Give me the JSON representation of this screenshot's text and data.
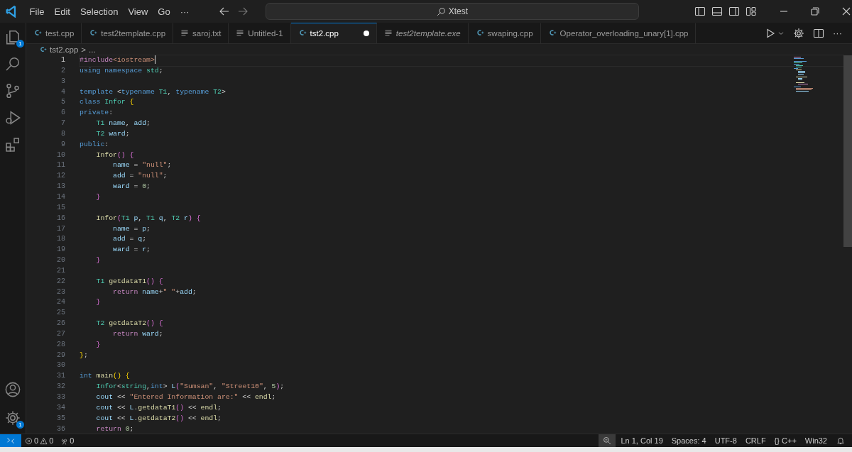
{
  "title_bar": {
    "menu": [
      "File",
      "Edit",
      "Selection",
      "View",
      "Go"
    ],
    "more": "···",
    "search": "Xtest"
  },
  "activity_bar": {
    "items": [
      {
        "kind": "explorer",
        "badge": "1"
      },
      {
        "kind": "search"
      },
      {
        "kind": "source-control"
      },
      {
        "kind": "run-debug"
      },
      {
        "kind": "extensions"
      }
    ],
    "bottom": [
      {
        "kind": "account"
      },
      {
        "kind": "settings",
        "badge": "1"
      }
    ]
  },
  "tabs": [
    {
      "label": "test.cpp",
      "kind": "cpp",
      "selected": false,
      "dirty": false,
      "preview": false
    },
    {
      "label": "test2template.cpp",
      "kind": "cpp",
      "selected": false,
      "dirty": false,
      "preview": false
    },
    {
      "label": "saroj.txt",
      "kind": "text",
      "selected": false,
      "dirty": false,
      "preview": false
    },
    {
      "label": "Untitled-1",
      "kind": "text",
      "selected": false,
      "dirty": false,
      "preview": false
    },
    {
      "label": "tst2.cpp",
      "kind": "cpp",
      "selected": true,
      "dirty": true,
      "preview": false
    },
    {
      "label": "test2template.exe",
      "kind": "text",
      "selected": false,
      "dirty": false,
      "preview": true
    },
    {
      "label": "swaping.cpp",
      "kind": "cpp",
      "selected": false,
      "dirty": false,
      "preview": false
    },
    {
      "label": "Operator_overloading_unary[1].cpp",
      "kind": "cpp",
      "selected": false,
      "dirty": false,
      "preview": false
    }
  ],
  "editor_actions": {
    "more": "···"
  },
  "breadcrumb": {
    "file": "tst2.cpp",
    "separator": ">",
    "rest": "..."
  },
  "lines": [
    {
      "number": "1",
      "current": true,
      "cursor": true,
      "tokens": [
        {
          "kind": "directive",
          "text": "#include"
        },
        {
          "kind": "string",
          "text": "<iostream>"
        }
      ]
    },
    {
      "number": "2",
      "tokens": [
        {
          "kind": "keyword",
          "text": "using"
        },
        {
          "kind": "keyword",
          "text": " namespace"
        },
        {
          "kind": "type",
          "text": " std"
        },
        {
          "kind": "plain",
          "text": ";"
        }
      ]
    },
    {
      "number": "3"
    },
    {
      "number": "4",
      "tokens": [
        {
          "kind": "keyword",
          "text": "template"
        },
        {
          "kind": "plain",
          "text": " <"
        },
        {
          "kind": "keyword",
          "text": "typename"
        },
        {
          "kind": "type",
          "text": " T1"
        },
        {
          "kind": "plain",
          "text": ", "
        },
        {
          "kind": "keyword",
          "text": "typename"
        },
        {
          "kind": "type",
          "text": " T2"
        },
        {
          "kind": "plain",
          "text": ">"
        }
      ]
    },
    {
      "number": "5",
      "tokens": [
        {
          "kind": "keyword",
          "text": "class"
        },
        {
          "kind": "type",
          "text": " Infor"
        },
        {
          "kind": "bracket1",
          "text": " {"
        }
      ]
    },
    {
      "number": "6",
      "tokens": [
        {
          "kind": "keyword",
          "text": "private"
        },
        {
          "kind": "plain",
          "text": ":"
        }
      ]
    },
    {
      "number": "7",
      "tokens": [
        {
          "kind": "type",
          "text": "    T1"
        },
        {
          "kind": "variable",
          "text": " name"
        },
        {
          "kind": "plain",
          "text": ", "
        },
        {
          "kind": "variable",
          "text": "add"
        },
        {
          "kind": "plain",
          "text": ";"
        }
      ]
    },
    {
      "number": "8",
      "tokens": [
        {
          "kind": "type",
          "text": "    T2"
        },
        {
          "kind": "variable",
          "text": " ward"
        },
        {
          "kind": "plain",
          "text": ";"
        }
      ]
    },
    {
      "number": "9",
      "tokens": [
        {
          "kind": "keyword",
          "text": "public"
        },
        {
          "kind": "plain",
          "text": ":"
        }
      ]
    },
    {
      "number": "10",
      "tokens": [
        {
          "kind": "function",
          "text": "    Infor"
        },
        {
          "kind": "bracket2",
          "text": "()"
        },
        {
          "kind": "bracket2",
          "text": " {"
        }
      ]
    },
    {
      "number": "11",
      "tokens": [
        {
          "kind": "variable",
          "text": "        name"
        },
        {
          "kind": "plain",
          "text": " = "
        },
        {
          "kind": "string",
          "text": "\"null\""
        },
        {
          "kind": "plain",
          "text": ";"
        }
      ]
    },
    {
      "number": "12",
      "tokens": [
        {
          "kind": "variable",
          "text": "        add"
        },
        {
          "kind": "plain",
          "text": " = "
        },
        {
          "kind": "string",
          "text": "\"null\""
        },
        {
          "kind": "plain",
          "text": ";"
        }
      ]
    },
    {
      "number": "13",
      "tokens": [
        {
          "kind": "variable",
          "text": "        ward"
        },
        {
          "kind": "plain",
          "text": " = "
        },
        {
          "kind": "number",
          "text": "0"
        },
        {
          "kind": "plain",
          "text": ";"
        }
      ]
    },
    {
      "number": "14",
      "tokens": [
        {
          "kind": "bracket2",
          "text": "    }"
        }
      ]
    },
    {
      "number": "15"
    },
    {
      "number": "16",
      "tokens": [
        {
          "kind": "function",
          "text": "    Infor"
        },
        {
          "kind": "bracket2",
          "text": "("
        },
        {
          "kind": "type",
          "text": "T1"
        },
        {
          "kind": "variable",
          "text": " p"
        },
        {
          "kind": "plain",
          "text": ", "
        },
        {
          "kind": "type",
          "text": "T1"
        },
        {
          "kind": "variable",
          "text": " q"
        },
        {
          "kind": "plain",
          "text": ", "
        },
        {
          "kind": "type",
          "text": "T2"
        },
        {
          "kind": "variable",
          "text": " r"
        },
        {
          "kind": "bracket2",
          "text": ")"
        },
        {
          "kind": "bracket2",
          "text": " {"
        }
      ]
    },
    {
      "number": "17",
      "tokens": [
        {
          "kind": "variable",
          "text": "        name"
        },
        {
          "kind": "plain",
          "text": " = "
        },
        {
          "kind": "variable",
          "text": "p"
        },
        {
          "kind": "plain",
          "text": ";"
        }
      ]
    },
    {
      "number": "18",
      "tokens": [
        {
          "kind": "variable",
          "text": "        add"
        },
        {
          "kind": "plain",
          "text": " = "
        },
        {
          "kind": "variable",
          "text": "q"
        },
        {
          "kind": "plain",
          "text": ";"
        }
      ]
    },
    {
      "number": "19",
      "tokens": [
        {
          "kind": "variable",
          "text": "        ward"
        },
        {
          "kind": "plain",
          "text": " = "
        },
        {
          "kind": "variable",
          "text": "r"
        },
        {
          "kind": "plain",
          "text": ";"
        }
      ]
    },
    {
      "number": "20",
      "tokens": [
        {
          "kind": "bracket2",
          "text": "    }"
        }
      ]
    },
    {
      "number": "21"
    },
    {
      "number": "22",
      "tokens": [
        {
          "kind": "type",
          "text": "    T1"
        },
        {
          "kind": "function",
          "text": " getdataT1"
        },
        {
          "kind": "bracket2",
          "text": "()"
        },
        {
          "kind": "bracket2",
          "text": " {"
        }
      ]
    },
    {
      "number": "23",
      "tokens": [
        {
          "kind": "control",
          "text": "        return"
        },
        {
          "kind": "variable",
          "text": " name"
        },
        {
          "kind": "plain",
          "text": "+"
        },
        {
          "kind": "string",
          "text": "\" \""
        },
        {
          "kind": "plain",
          "text": "+"
        },
        {
          "kind": "variable",
          "text": "add"
        },
        {
          "kind": "plain",
          "text": ";"
        }
      ]
    },
    {
      "number": "24",
      "tokens": [
        {
          "kind": "bracket2",
          "text": "    }"
        }
      ]
    },
    {
      "number": "25"
    },
    {
      "number": "26",
      "tokens": [
        {
          "kind": "type",
          "text": "    T2"
        },
        {
          "kind": "function",
          "text": " getdataT2"
        },
        {
          "kind": "bracket2",
          "text": "()"
        },
        {
          "kind": "bracket2",
          "text": " {"
        }
      ]
    },
    {
      "number": "27",
      "tokens": [
        {
          "kind": "control",
          "text": "        return"
        },
        {
          "kind": "variable",
          "text": " ward"
        },
        {
          "kind": "plain",
          "text": ";"
        }
      ]
    },
    {
      "number": "28",
      "tokens": [
        {
          "kind": "bracket2",
          "text": "    }"
        }
      ]
    },
    {
      "number": "29",
      "tokens": [
        {
          "kind": "bracket1",
          "text": "}"
        },
        {
          "kind": "plain",
          "text": ";"
        }
      ]
    },
    {
      "number": "30"
    },
    {
      "number": "31",
      "tokens": [
        {
          "kind": "keyword",
          "text": "int"
        },
        {
          "kind": "function",
          "text": " main"
        },
        {
          "kind": "bracket1",
          "text": "()"
        },
        {
          "kind": "bracket1",
          "text": " {"
        }
      ]
    },
    {
      "number": "32",
      "tokens": [
        {
          "kind": "type",
          "text": "    Infor"
        },
        {
          "kind": "plain",
          "text": "<"
        },
        {
          "kind": "type",
          "text": "string"
        },
        {
          "kind": "plain",
          "text": ","
        },
        {
          "kind": "keyword",
          "text": "int"
        },
        {
          "kind": "plain",
          "text": "> "
        },
        {
          "kind": "variable",
          "text": "L"
        },
        {
          "kind": "bracket2",
          "text": "("
        },
        {
          "kind": "string",
          "text": "\"Sumsan\""
        },
        {
          "kind": "plain",
          "text": ", "
        },
        {
          "kind": "string",
          "text": "\"Street10\""
        },
        {
          "kind": "plain",
          "text": ", "
        },
        {
          "kind": "number",
          "text": "5"
        },
        {
          "kind": "bracket2",
          "text": ")"
        },
        {
          "kind": "plain",
          "text": ";"
        }
      ]
    },
    {
      "number": "33",
      "tokens": [
        {
          "kind": "variable",
          "text": "    cout"
        },
        {
          "kind": "plain",
          "text": " << "
        },
        {
          "kind": "string",
          "text": "\"Entered Information are:\""
        },
        {
          "kind": "plain",
          "text": " << "
        },
        {
          "kind": "function",
          "text": "endl"
        },
        {
          "kind": "plain",
          "text": ";"
        }
      ]
    },
    {
      "number": "34",
      "tokens": [
        {
          "kind": "variable",
          "text": "    cout"
        },
        {
          "kind": "plain",
          "text": " << "
        },
        {
          "kind": "variable",
          "text": "L"
        },
        {
          "kind": "plain",
          "text": "."
        },
        {
          "kind": "function",
          "text": "getdataT1"
        },
        {
          "kind": "bracket2",
          "text": "()"
        },
        {
          "kind": "plain",
          "text": " << "
        },
        {
          "kind": "function",
          "text": "endl"
        },
        {
          "kind": "plain",
          "text": ";"
        }
      ]
    },
    {
      "number": "35",
      "tokens": [
        {
          "kind": "variable",
          "text": "    cout"
        },
        {
          "kind": "plain",
          "text": " << "
        },
        {
          "kind": "variable",
          "text": "L"
        },
        {
          "kind": "plain",
          "text": "."
        },
        {
          "kind": "function",
          "text": "getdataT2"
        },
        {
          "kind": "bracket2",
          "text": "()"
        },
        {
          "kind": "plain",
          "text": " << "
        },
        {
          "kind": "function",
          "text": "endl"
        },
        {
          "kind": "plain",
          "text": ";"
        }
      ]
    },
    {
      "number": "36",
      "tokens": [
        {
          "kind": "control",
          "text": "    return"
        },
        {
          "kind": "number",
          "text": " 0"
        },
        {
          "kind": "plain",
          "text": ";"
        }
      ]
    }
  ],
  "status_bar": {
    "errors": "0",
    "warnings": "0",
    "ports": "0",
    "items": [
      "Ln 1, Col 19",
      "Spaces: 4",
      "UTF-8",
      "CRLF",
      "{} C++",
      "Win32"
    ]
  }
}
